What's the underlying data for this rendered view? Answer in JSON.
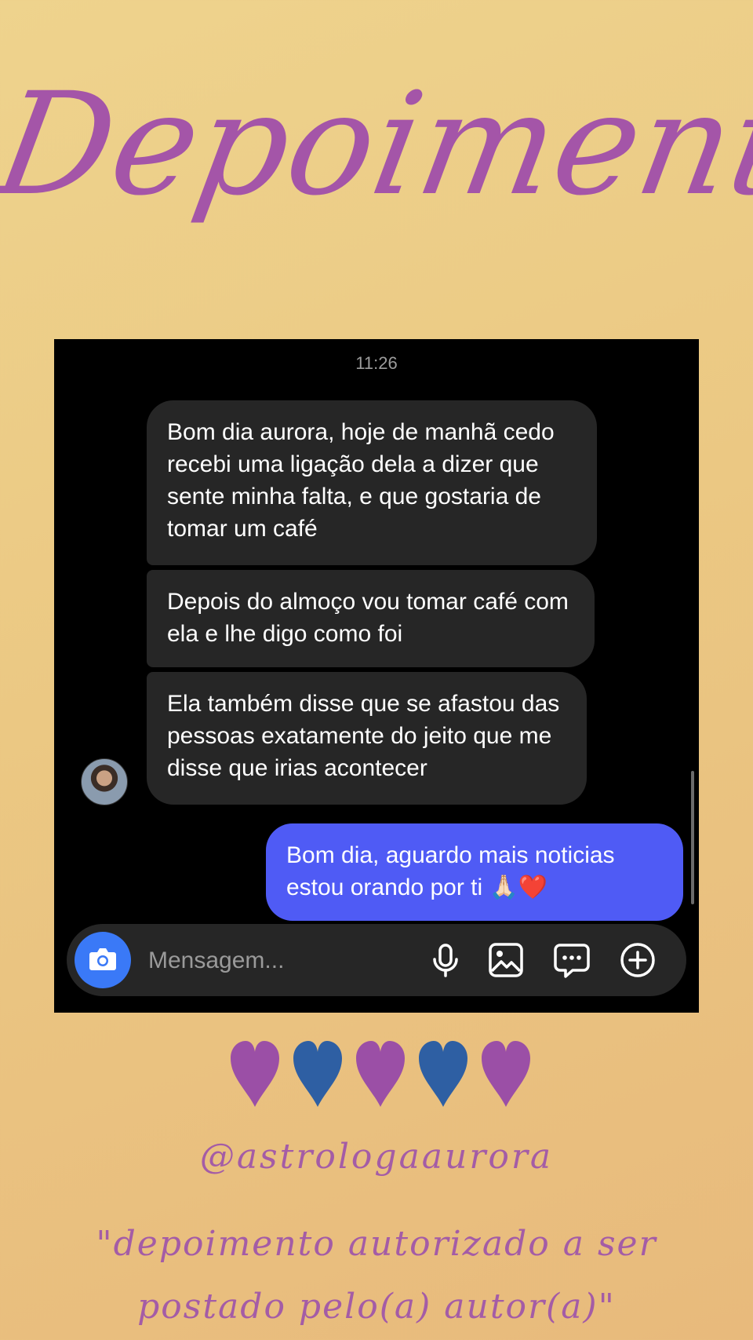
{
  "title": "Depoimentos",
  "chat": {
    "timestamp": "11:26",
    "messages": [
      {
        "direction": "received",
        "text": "Bom dia aurora, hoje de manhã cedo recebi uma ligação dela a dizer que sente minha falta, e que gostaria de tomar um café"
      },
      {
        "direction": "received",
        "text": "Depois do almoço vou tomar café com ela e lhe digo como foi"
      },
      {
        "direction": "received",
        "text": "Ela também disse que se afastou das pessoas exatamente do jeito que me disse que irias acontecer"
      },
      {
        "direction": "sent",
        "text": "Bom dia, aguardo mais noticias estou orando por ti 🙏🏻❤️"
      }
    ],
    "composer": {
      "placeholder": "Mensagem...",
      "icons": [
        "camera-icon",
        "microphone-icon",
        "image-icon",
        "sticker-icon",
        "plus-icon"
      ]
    }
  },
  "hearts": {
    "colors": [
      "#9b4fa6",
      "#2e5fa3",
      "#9b4fa6",
      "#2e5fa3",
      "#9b4fa6"
    ]
  },
  "handle": "@astrologaaurora",
  "caption": "\"depoimento autorizado a ser postado pelo(a) autor(a)\"",
  "colors": {
    "title": "#a455a8",
    "sent_bubble": "#4f5bf5",
    "received_bubble": "#262626",
    "camera_button": "#3a79f7"
  }
}
